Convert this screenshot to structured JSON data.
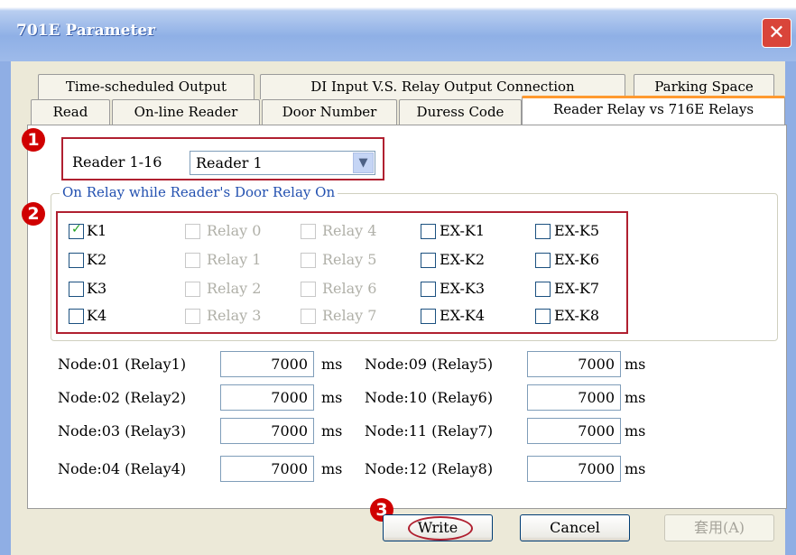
{
  "window": {
    "title": "701E Parameter",
    "close_symbol": "✕"
  },
  "tabs_row1": [
    {
      "label": "Time-scheduled Output"
    },
    {
      "label": "DI Input  V.S. Relay Output Connection"
    },
    {
      "label": "Parking Space"
    }
  ],
  "tabs_row2": [
    {
      "label": "Read"
    },
    {
      "label": "On-line Reader"
    },
    {
      "label": "Door Number"
    },
    {
      "label": "Duress Code"
    },
    {
      "label": "Reader Relay vs 716E Relays",
      "active": true
    }
  ],
  "markers": [
    "1",
    "2",
    "3"
  ],
  "reader": {
    "label": "Reader 1-16",
    "selected": "Reader 1",
    "arrow": "▼"
  },
  "relay_group": {
    "legend": "On Relay while Reader's Door Relay On",
    "k": [
      {
        "label": "K1",
        "checked": true
      },
      {
        "label": "K2",
        "checked": false
      },
      {
        "label": "K3",
        "checked": false
      },
      {
        "label": "K4",
        "checked": false
      }
    ],
    "relay_a": [
      "Relay 0",
      "Relay 1",
      "Relay 2",
      "Relay 3"
    ],
    "relay_b": [
      "Relay 4",
      "Relay 5",
      "Relay 6",
      "Relay 7"
    ],
    "exk_a": [
      "EX-K1",
      "EX-K2",
      "EX-K3",
      "EX-K4"
    ],
    "exk_b": [
      "EX-K5",
      "EX-K6",
      "EX-K7",
      "EX-K8"
    ],
    "check_symbol": "✓"
  },
  "nodes_left": [
    {
      "label": "Node:01 (Relay1)",
      "value": "7000",
      "unit": "ms"
    },
    {
      "label": "Node:02 (Relay2)",
      "value": "7000",
      "unit": "ms"
    },
    {
      "label": "Node:03 (Relay3)",
      "value": "7000",
      "unit": "ms"
    },
    {
      "label": "Node:04 (Relay4)",
      "value": "7000",
      "unit": "ms"
    }
  ],
  "nodes_right": [
    {
      "label": "Node:09 (Relay5)",
      "value": "7000",
      "unit": "ms"
    },
    {
      "label": "Node:10 (Relay6)",
      "value": "7000",
      "unit": "ms"
    },
    {
      "label": "Node:11 (Relay7)",
      "value": "7000",
      "unit": "ms"
    },
    {
      "label": "Node:12 (Relay8)",
      "value": "7000",
      "unit": "ms"
    }
  ],
  "buttons": {
    "write": "Write",
    "cancel": "Cancel",
    "apply": "套用(A)"
  }
}
